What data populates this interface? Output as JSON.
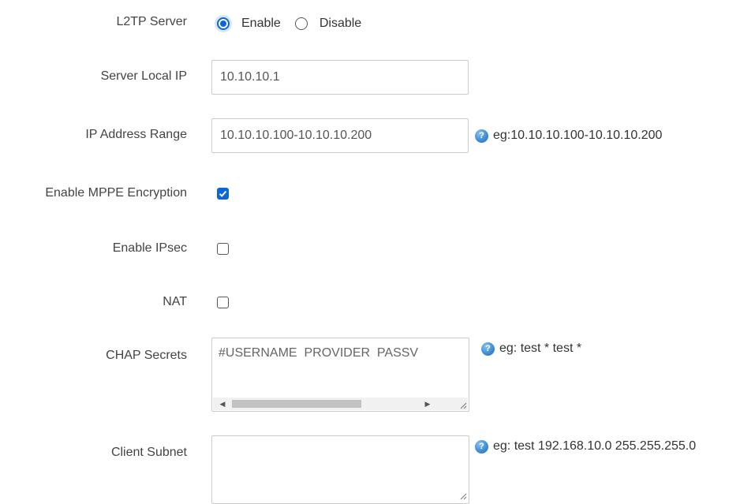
{
  "l2tp_server": {
    "label": "L2TP Server",
    "options": [
      {
        "label": "Enable",
        "checked": true
      },
      {
        "label": "Disable",
        "checked": false
      }
    ]
  },
  "server_local_ip": {
    "label": "Server Local IP",
    "value": "10.10.10.1"
  },
  "ip_address_range": {
    "label": "IP Address Range",
    "value": "10.10.10.100-10.10.10.200",
    "help": "eg:10.10.10.100-10.10.10.200"
  },
  "mppe": {
    "label": "Enable MPPE Encryption",
    "checked": true
  },
  "ipsec": {
    "label": "Enable IPsec",
    "checked": false
  },
  "nat": {
    "label": "NAT",
    "checked": false
  },
  "chap_secrets": {
    "label": "CHAP Secrets",
    "value": "#USERNAME  PROVIDER  PASSV",
    "help": "eg: test * test *"
  },
  "client_subnet": {
    "label": "Client Subnet",
    "value": "",
    "help": "eg: test 192.168.10.0 255.255.255.0"
  },
  "colors": {
    "accent": "#0a66d8",
    "border": "#cccccc",
    "help_icon": "#3f8fd6"
  },
  "icons": {
    "help": "help-question-icon",
    "resize": "resize-grip-icon"
  }
}
